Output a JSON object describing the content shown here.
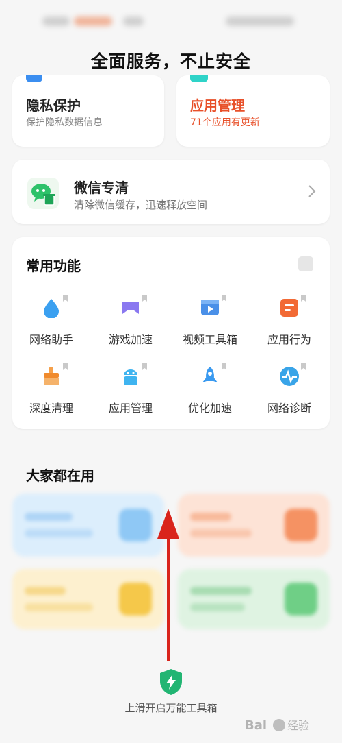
{
  "header": {
    "title": "全面服务，不止安全"
  },
  "privacy_card": {
    "title": "隐私保护",
    "subtitle": "保护隐私数据信息"
  },
  "app_card": {
    "title": "应用管理",
    "subtitle": "71个应用有更新"
  },
  "wechat_card": {
    "title": "微信专清",
    "subtitle": "清除微信缓存，迅速释放空间"
  },
  "common": {
    "title": "常用功能",
    "items": [
      {
        "label": "网络助手",
        "icon": "water-drop-icon"
      },
      {
        "label": "游戏加速",
        "icon": "gamepad-icon"
      },
      {
        "label": "视频工具箱",
        "icon": "video-icon"
      },
      {
        "label": "应用行为",
        "icon": "app-behavior-icon"
      },
      {
        "label": "深度清理",
        "icon": "broom-icon"
      },
      {
        "label": "应用管理",
        "icon": "android-icon"
      },
      {
        "label": "优化加速",
        "icon": "rocket-icon"
      },
      {
        "label": "网络诊断",
        "icon": "pulse-icon"
      }
    ]
  },
  "popular": {
    "title": "大家都在用"
  },
  "bottom": {
    "hint": "上滑开启万能工具箱"
  },
  "colors": {
    "accent_orange": "#e8502a",
    "blue": "#3b8ef0",
    "green": "#2ec26a"
  }
}
